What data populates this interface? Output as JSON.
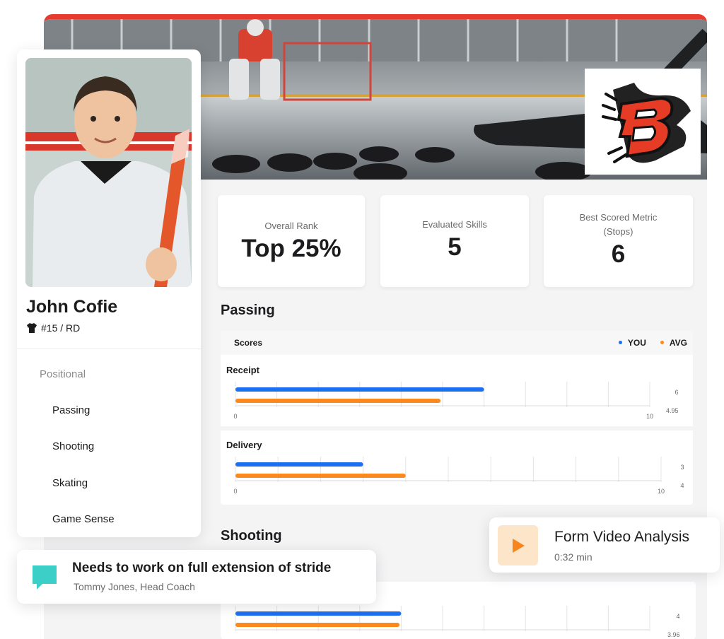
{
  "player": {
    "name": "John Cofie",
    "jersey": "#15 / RD"
  },
  "stats": [
    {
      "label": "Overall Rank",
      "value": "Top 25%"
    },
    {
      "label": "Evaluated Skills",
      "value": "5"
    },
    {
      "label_line1": "Best Scored Metric",
      "label_line2": "(Stops)",
      "value": "6"
    }
  ],
  "nav": {
    "group": "Positional",
    "items": [
      "Passing",
      "Shooting",
      "Skating",
      "Game Sense"
    ]
  },
  "passing": {
    "title": "Passing",
    "header": "Scores",
    "legend": {
      "you": "YOU",
      "avg": "AVG"
    },
    "metrics": [
      {
        "name": "Receipt",
        "you": 6,
        "avg": 4.95,
        "you_label": "6",
        "avg_label": "4.95",
        "min_label": "0",
        "max_label": "10"
      },
      {
        "name": "Delivery",
        "you": 3,
        "avg": 4,
        "you_label": "3",
        "avg_label": "4",
        "min_label": "0",
        "max_label": "10"
      }
    ]
  },
  "shooting": {
    "title": "Shooting",
    "metrics": [
      {
        "you": 4,
        "avg": 3.96,
        "you_label": "4",
        "avg_label": "3.96"
      }
    ]
  },
  "coach_note": {
    "text": "Needs to work on full extension of stride",
    "author": "Tommy Jones, Head Coach"
  },
  "video": {
    "title": "Form Video Analysis",
    "duration": "0:32 min"
  },
  "colors": {
    "you": "#1d6ff2",
    "avg": "#fb8a1e",
    "accent": "#e63b2e",
    "chat_icon": "#3ccfc7",
    "play_icon": "#f7841d"
  },
  "icons": [
    "jersey-icon",
    "chat-bubble-icon",
    "play-icon",
    "team-logo"
  ]
}
